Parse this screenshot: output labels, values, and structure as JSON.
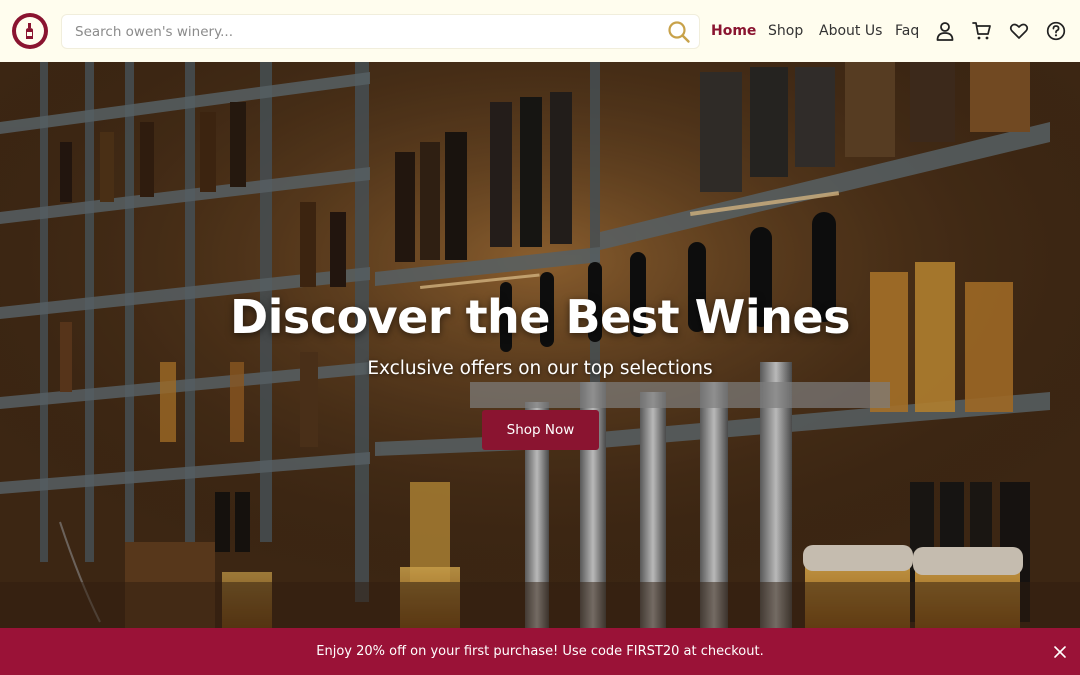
{
  "header": {
    "logo_icon": "winery-logo-icon",
    "search": {
      "placeholder": "Search owen's winery...",
      "value": "",
      "icon": "search-icon"
    },
    "nav": [
      {
        "label": "Home",
        "active": true
      },
      {
        "label": "Shop",
        "active": false
      },
      {
        "label": "About Us",
        "active": false
      },
      {
        "label": "Faq",
        "active": false
      }
    ],
    "icons": [
      "user-icon",
      "cart-icon",
      "heart-icon",
      "help-icon"
    ]
  },
  "hero": {
    "title": "Discover the Best Wines",
    "subtitle": "Exclusive offers on our top selections",
    "cta_label": "Shop Now"
  },
  "promo": {
    "text": "Enjoy 20% off on your first purchase! Use code FIRST20 at checkout.",
    "close_icon": "close-icon"
  },
  "colors": {
    "brand": "#8a1430",
    "promo_bg": "#9a1237",
    "header_bg": "#fffdee",
    "search_icon": "#c8a24a"
  }
}
